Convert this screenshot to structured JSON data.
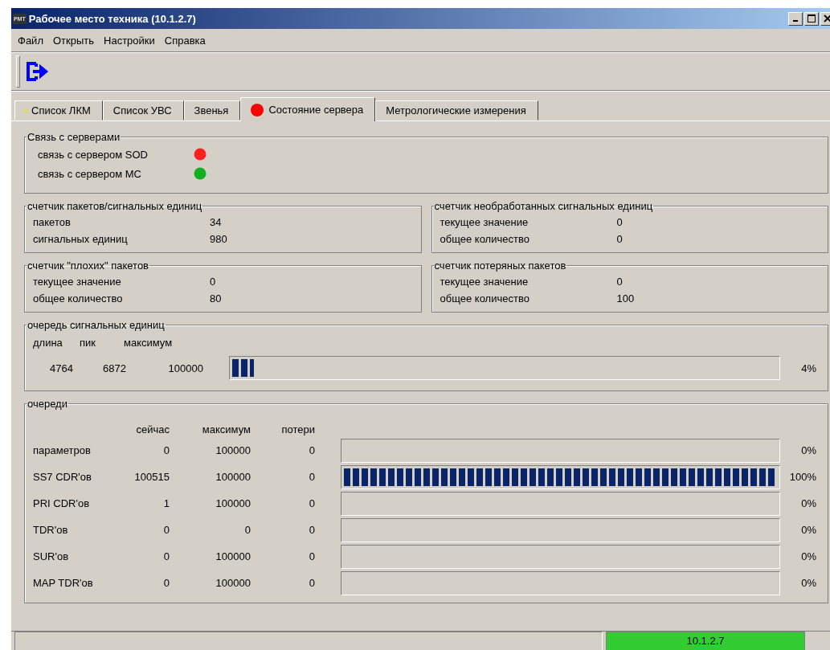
{
  "window": {
    "title": "Рабочее место техника (10.1.2.7)",
    "app_icon_text": "РМТ"
  },
  "menu": [
    "Файл",
    "Открыть",
    "Настройки",
    "Справка"
  ],
  "tabs": [
    {
      "label": "Список ЛКМ",
      "selected": false,
      "color": "#e8e800"
    },
    {
      "label": "Список УВС",
      "selected": false
    },
    {
      "label": "Звенья",
      "selected": false
    },
    {
      "label": "Состояние сервера",
      "selected": true,
      "color": "#ff0000"
    },
    {
      "label": "Метрологические измерения",
      "selected": false
    }
  ],
  "servers": {
    "title": "Связь с серверами",
    "items": [
      {
        "label": "связь с сервером SOD",
        "color": "#ff2020"
      },
      {
        "label": "связь с сервером МС",
        "color": "#10b020"
      }
    ]
  },
  "counters": [
    {
      "title": "счетчик пакетов/сигнальных единиц",
      "rows": [
        {
          "label": "пакетов",
          "value": "34"
        },
        {
          "label": "сигнальных единиц",
          "value": "980"
        }
      ]
    },
    {
      "title": "счетчик необработанных сигнальных единиц",
      "rows": [
        {
          "label": "текущее значение",
          "value": "0"
        },
        {
          "label": "общее количество",
          "value": "0"
        }
      ]
    },
    {
      "title": "счетчик \"плохих\" пакетов",
      "rows": [
        {
          "label": "текущее значение",
          "value": "0"
        },
        {
          "label": "общее количество",
          "value": "80"
        }
      ]
    },
    {
      "title": "счетчик потеряных пакетов",
      "rows": [
        {
          "label": "текущее значение",
          "value": "0"
        },
        {
          "label": "общее количество",
          "value": "100"
        }
      ]
    }
  ],
  "signal_queue": {
    "title": "очередь сигнальных единиц",
    "columns": [
      "длина",
      "пик",
      "максимум"
    ],
    "values": [
      "4764",
      "6872",
      "100000"
    ],
    "level": 0.04,
    "percent": "4%"
  },
  "queues": {
    "title": "очереди",
    "columns": [
      "сейчас",
      "максимум",
      "потери"
    ],
    "rows": [
      {
        "name": "параметров",
        "now": "0",
        "max": "100000",
        "loss": "0",
        "percent": "0%"
      },
      {
        "name": "SS7 CDR'ов",
        "now": "100515",
        "max": "100000",
        "loss": "0",
        "level": 1,
        "percent": "100%"
      },
      {
        "name": "PRI CDR'ов",
        "now": "1",
        "max": "100000",
        "loss": "0",
        "percent": "0%"
      },
      {
        "name": "TDR'ов",
        "now": "0",
        "max": "0",
        "loss": "0",
        "percent": "0%"
      },
      {
        "name": "SUR'ов",
        "now": "0",
        "max": "100000",
        "loss": "0",
        "percent": "0%"
      },
      {
        "name": "MAP TDR'ов",
        "now": "0",
        "max": "100000",
        "loss": "0",
        "percent": "0%"
      }
    ]
  },
  "status_bar": {
    "address": "10.1.2.7"
  }
}
